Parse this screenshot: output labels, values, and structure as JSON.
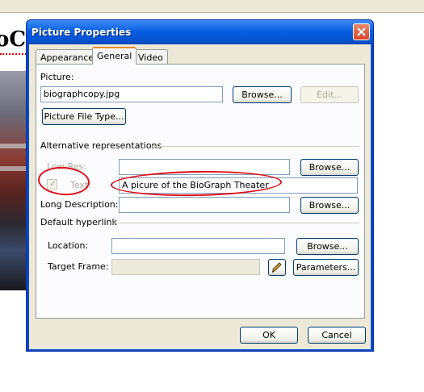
{
  "page": {
    "heading_fragment": "oC"
  },
  "dialog": {
    "title": "Picture Properties",
    "tabs": [
      {
        "label": "Appearance",
        "active": false
      },
      {
        "label": "General",
        "active": true
      },
      {
        "label": "Video",
        "active": false
      }
    ],
    "picture_label": "Picture:",
    "picture_value": "biographcopy.jpg",
    "browse_label": "Browse...",
    "edit_label": "Edit...",
    "picture_file_type_label": "Picture File Type...",
    "alt_group_label": "Alternative representations",
    "low_res_label": "Low-Res:",
    "low_res_value": "",
    "low_res_browse": "Browse...",
    "text_label": "Text:",
    "text_checked": true,
    "text_value": "A picure of the BioGraph Theater",
    "long_desc_label": "Long Description:",
    "long_desc_value": "",
    "long_desc_browse": "Browse...",
    "hyperlink_group_label": "Default hyperlink",
    "location_label": "Location:",
    "location_value": "",
    "location_browse": "Browse...",
    "target_frame_label": "Target Frame:",
    "target_frame_value": "",
    "parameters_label": "Parameters...",
    "ok_label": "OK",
    "cancel_label": "Cancel",
    "check_glyph": "✓"
  }
}
